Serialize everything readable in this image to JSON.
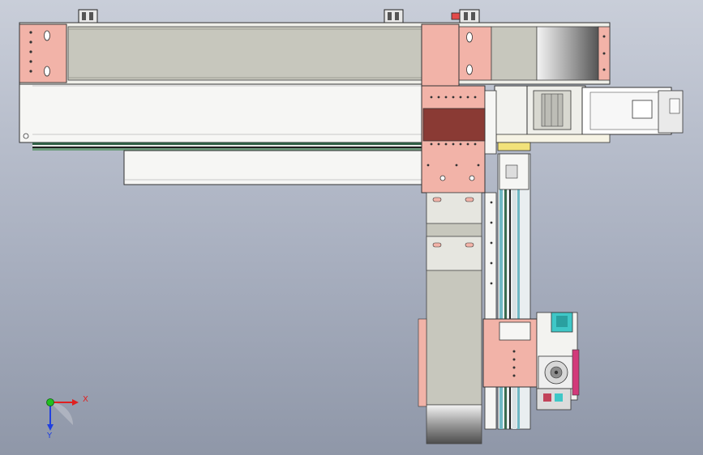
{
  "viewport": {
    "background_top": "#c9ced9",
    "background_bottom": "#8f97a8"
  },
  "colors": {
    "frame_pink": "#f2b3a8",
    "frame_pink_dark": "#d98e82",
    "beam_grey": "#c7c7bd",
    "inner_white": "#f6f6f4",
    "rail_green": "#3a6b4f",
    "rail_teal": "#6fb8c4",
    "sensor_cyan": "#3fc7c7",
    "motor_grey": "#dcdcdc",
    "highlight_maroon": "#8a3a34",
    "yellow_plate": "#f2e27a",
    "magenta_part": "#d23a7a"
  },
  "triad": {
    "x_label": "X",
    "y_label": "Y",
    "x_color": "#e02020",
    "y_color": "#20c020",
    "z_color": "#2040e0"
  }
}
